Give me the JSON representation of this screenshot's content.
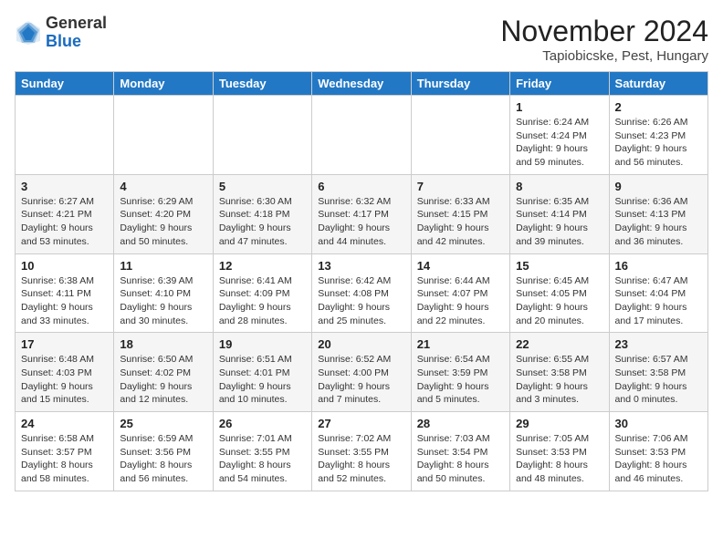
{
  "logo": {
    "general": "General",
    "blue": "Blue"
  },
  "title": "November 2024",
  "location": "Tapiobicske, Pest, Hungary",
  "weekdays": [
    "Sunday",
    "Monday",
    "Tuesday",
    "Wednesday",
    "Thursday",
    "Friday",
    "Saturday"
  ],
  "weeks": [
    [
      {
        "day": "",
        "info": ""
      },
      {
        "day": "",
        "info": ""
      },
      {
        "day": "",
        "info": ""
      },
      {
        "day": "",
        "info": ""
      },
      {
        "day": "",
        "info": ""
      },
      {
        "day": "1",
        "info": "Sunrise: 6:24 AM\nSunset: 4:24 PM\nDaylight: 9 hours and 59 minutes."
      },
      {
        "day": "2",
        "info": "Sunrise: 6:26 AM\nSunset: 4:23 PM\nDaylight: 9 hours and 56 minutes."
      }
    ],
    [
      {
        "day": "3",
        "info": "Sunrise: 6:27 AM\nSunset: 4:21 PM\nDaylight: 9 hours and 53 minutes."
      },
      {
        "day": "4",
        "info": "Sunrise: 6:29 AM\nSunset: 4:20 PM\nDaylight: 9 hours and 50 minutes."
      },
      {
        "day": "5",
        "info": "Sunrise: 6:30 AM\nSunset: 4:18 PM\nDaylight: 9 hours and 47 minutes."
      },
      {
        "day": "6",
        "info": "Sunrise: 6:32 AM\nSunset: 4:17 PM\nDaylight: 9 hours and 44 minutes."
      },
      {
        "day": "7",
        "info": "Sunrise: 6:33 AM\nSunset: 4:15 PM\nDaylight: 9 hours and 42 minutes."
      },
      {
        "day": "8",
        "info": "Sunrise: 6:35 AM\nSunset: 4:14 PM\nDaylight: 9 hours and 39 minutes."
      },
      {
        "day": "9",
        "info": "Sunrise: 6:36 AM\nSunset: 4:13 PM\nDaylight: 9 hours and 36 minutes."
      }
    ],
    [
      {
        "day": "10",
        "info": "Sunrise: 6:38 AM\nSunset: 4:11 PM\nDaylight: 9 hours and 33 minutes."
      },
      {
        "day": "11",
        "info": "Sunrise: 6:39 AM\nSunset: 4:10 PM\nDaylight: 9 hours and 30 minutes."
      },
      {
        "day": "12",
        "info": "Sunrise: 6:41 AM\nSunset: 4:09 PM\nDaylight: 9 hours and 28 minutes."
      },
      {
        "day": "13",
        "info": "Sunrise: 6:42 AM\nSunset: 4:08 PM\nDaylight: 9 hours and 25 minutes."
      },
      {
        "day": "14",
        "info": "Sunrise: 6:44 AM\nSunset: 4:07 PM\nDaylight: 9 hours and 22 minutes."
      },
      {
        "day": "15",
        "info": "Sunrise: 6:45 AM\nSunset: 4:05 PM\nDaylight: 9 hours and 20 minutes."
      },
      {
        "day": "16",
        "info": "Sunrise: 6:47 AM\nSunset: 4:04 PM\nDaylight: 9 hours and 17 minutes."
      }
    ],
    [
      {
        "day": "17",
        "info": "Sunrise: 6:48 AM\nSunset: 4:03 PM\nDaylight: 9 hours and 15 minutes."
      },
      {
        "day": "18",
        "info": "Sunrise: 6:50 AM\nSunset: 4:02 PM\nDaylight: 9 hours and 12 minutes."
      },
      {
        "day": "19",
        "info": "Sunrise: 6:51 AM\nSunset: 4:01 PM\nDaylight: 9 hours and 10 minutes."
      },
      {
        "day": "20",
        "info": "Sunrise: 6:52 AM\nSunset: 4:00 PM\nDaylight: 9 hours and 7 minutes."
      },
      {
        "day": "21",
        "info": "Sunrise: 6:54 AM\nSunset: 3:59 PM\nDaylight: 9 hours and 5 minutes."
      },
      {
        "day": "22",
        "info": "Sunrise: 6:55 AM\nSunset: 3:58 PM\nDaylight: 9 hours and 3 minutes."
      },
      {
        "day": "23",
        "info": "Sunrise: 6:57 AM\nSunset: 3:58 PM\nDaylight: 9 hours and 0 minutes."
      }
    ],
    [
      {
        "day": "24",
        "info": "Sunrise: 6:58 AM\nSunset: 3:57 PM\nDaylight: 8 hours and 58 minutes."
      },
      {
        "day": "25",
        "info": "Sunrise: 6:59 AM\nSunset: 3:56 PM\nDaylight: 8 hours and 56 minutes."
      },
      {
        "day": "26",
        "info": "Sunrise: 7:01 AM\nSunset: 3:55 PM\nDaylight: 8 hours and 54 minutes."
      },
      {
        "day": "27",
        "info": "Sunrise: 7:02 AM\nSunset: 3:55 PM\nDaylight: 8 hours and 52 minutes."
      },
      {
        "day": "28",
        "info": "Sunrise: 7:03 AM\nSunset: 3:54 PM\nDaylight: 8 hours and 50 minutes."
      },
      {
        "day": "29",
        "info": "Sunrise: 7:05 AM\nSunset: 3:53 PM\nDaylight: 8 hours and 48 minutes."
      },
      {
        "day": "30",
        "info": "Sunrise: 7:06 AM\nSunset: 3:53 PM\nDaylight: 8 hours and 46 minutes."
      }
    ]
  ]
}
